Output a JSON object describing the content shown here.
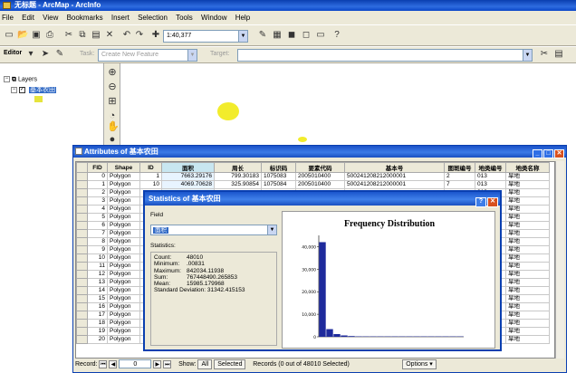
{
  "app": {
    "title": "无标题 - ArcMap - ArcInfo"
  },
  "menu": [
    "File",
    "Edit",
    "View",
    "Bookmarks",
    "Insert",
    "Selection",
    "Tools",
    "Window",
    "Help"
  ],
  "toolbar": {
    "scale": "1:40,377",
    "editor_label": "Editor",
    "task_label": "Task:",
    "task_value": "Create New Feature",
    "target_label": "Target:"
  },
  "toc": {
    "root": "Layers",
    "layer": "基本农田"
  },
  "attributes": {
    "title": "Attributes of 基本农田",
    "columns": [
      "FID",
      "Shape",
      "ID",
      "面积",
      "周长",
      "标识码",
      "要素代码",
      "基本号",
      "图斑编号",
      "地类编号",
      "地类名称"
    ],
    "rows": [
      [
        "0",
        "Polygon",
        "1",
        "7663.29176",
        "799.30183",
        "1075083",
        "2005010400",
        "500241208212000001",
        "2",
        "013",
        "旱地"
      ],
      [
        "1",
        "Polygon",
        "10",
        "4069.70628",
        "325.90854",
        "1075084",
        "2005010400",
        "500241208212000001",
        "7",
        "013",
        "旱地"
      ],
      [
        "2",
        "Polygon",
        "",
        "",
        "",
        "",
        "",
        "",
        "",
        "013",
        "旱地"
      ],
      [
        "3",
        "Polygon",
        "",
        "",
        "",
        "",
        "",
        "",
        "",
        "013",
        "旱地"
      ],
      [
        "4",
        "Polygon",
        "",
        "",
        "",
        "",
        "",
        "",
        "",
        "013",
        "旱地"
      ],
      [
        "5",
        "Polygon",
        "",
        "",
        "",
        "",
        "",
        "",
        "",
        "013",
        "旱地"
      ],
      [
        "6",
        "Polygon",
        "",
        "",
        "",
        "",
        "",
        "",
        "",
        "013",
        "旱地"
      ],
      [
        "7",
        "Polygon",
        "",
        "",
        "",
        "",
        "",
        "",
        "",
        "013",
        "旱地"
      ],
      [
        "8",
        "Polygon",
        "",
        "",
        "",
        "",
        "",
        "",
        "",
        "013",
        "旱地"
      ],
      [
        "9",
        "Polygon",
        "",
        "",
        "",
        "",
        "",
        "",
        "",
        "013",
        "旱地"
      ],
      [
        "10",
        "Polygon",
        "",
        "",
        "",
        "",
        "",
        "",
        "",
        "013",
        "旱地"
      ],
      [
        "11",
        "Polygon",
        "",
        "",
        "",
        "",
        "",
        "",
        "",
        "013",
        "旱地"
      ],
      [
        "12",
        "Polygon",
        "",
        "",
        "",
        "",
        "",
        "",
        "",
        "013",
        "旱地"
      ],
      [
        "13",
        "Polygon",
        "",
        "",
        "",
        "",
        "",
        "",
        "",
        "013",
        "旱地"
      ],
      [
        "14",
        "Polygon",
        "",
        "",
        "",
        "",
        "",
        "",
        "",
        "013",
        "旱地"
      ],
      [
        "15",
        "Polygon",
        "",
        "",
        "",
        "",
        "",
        "",
        "",
        "013",
        "旱地"
      ],
      [
        "16",
        "Polygon",
        "",
        "",
        "",
        "",
        "",
        "",
        "",
        "013",
        "旱地"
      ],
      [
        "17",
        "Polygon",
        "",
        "",
        "",
        "",
        "",
        "",
        "",
        "013",
        "旱地"
      ],
      [
        "18",
        "Polygon",
        "",
        "",
        "",
        "",
        "",
        "",
        "",
        "013",
        "旱地"
      ],
      [
        "19",
        "Polygon",
        "",
        "",
        "",
        "",
        "",
        "",
        "",
        "013",
        "旱地"
      ],
      [
        "20",
        "Polygon",
        "",
        "",
        "",
        "",
        "",
        "",
        "",
        "013",
        "旱地"
      ]
    ],
    "footer": {
      "record_label": "Record:",
      "record_value": "0",
      "show_label": "Show:",
      "all_label": "All",
      "selected_label": "Selected",
      "records_text": "Records (0 out of 48010 Selected)",
      "options_label": "Options"
    }
  },
  "statistics": {
    "title": "Statistics of 基本农田",
    "field_label": "Field",
    "field_value": "面积",
    "stats_heading": "Statistics:",
    "lines": [
      {
        "label": "Count:",
        "value": "48010"
      },
      {
        "label": "Minimum:",
        "value": ".00831"
      },
      {
        "label": "Maximum:",
        "value": "842034.11938"
      },
      {
        "label": "Sum:",
        "value": "767448490.265853"
      },
      {
        "label": "Mean:",
        "value": "15985.179968"
      },
      {
        "label": "Standard Deviation:",
        "value": "31342.415153"
      }
    ]
  },
  "chart_data": {
    "type": "bar",
    "title": "Frequency Distribution",
    "ylim": [
      0,
      45000
    ],
    "y_ticks": [
      "40,000",
      "30,000",
      "20,000",
      "10,000",
      "0"
    ],
    "values": [
      42000,
      3400,
      1200,
      600,
      320,
      180,
      110,
      70,
      50,
      30,
      20,
      12,
      8,
      5,
      3,
      2,
      1,
      1,
      1,
      1
    ]
  },
  "colors": {
    "title_blue": "#0a3fb0",
    "polygon_fill": "#f2ec2c",
    "bar_fill": "#1e2a9c"
  }
}
